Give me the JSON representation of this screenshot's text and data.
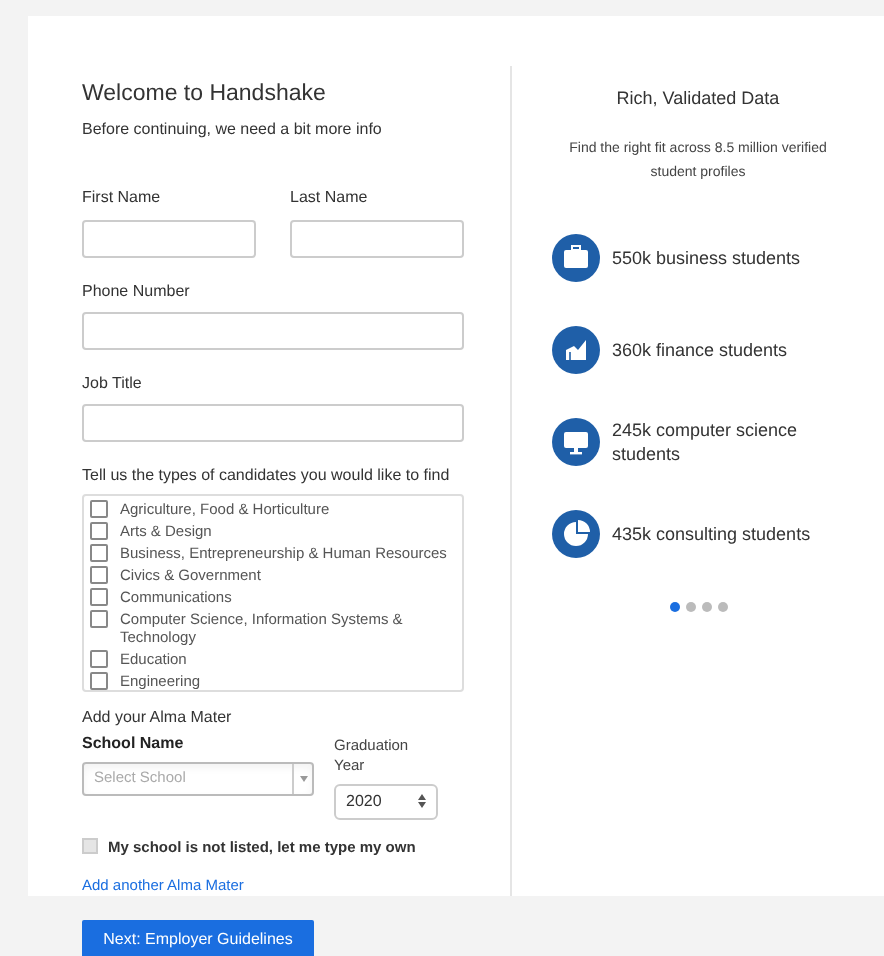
{
  "form": {
    "title": "Welcome to Handshake",
    "subtitle": "Before continuing, we need a bit more info",
    "first_name": {
      "label": "First Name"
    },
    "last_name": {
      "label": "Last Name"
    },
    "phone": {
      "label": "Phone Number"
    },
    "job_title": {
      "label": "Job Title"
    },
    "candidates": {
      "label": "Tell us the types of candidates you would like to find",
      "options": [
        {
          "label": "Agriculture, Food & Horticulture",
          "checked": false
        },
        {
          "label": "Arts & Design",
          "checked": false
        },
        {
          "label": "Business, Entrepreneurship & Human Resources",
          "checked": false
        },
        {
          "label": "Civics & Government",
          "checked": false
        },
        {
          "label": "Communications",
          "checked": false
        },
        {
          "label": "Computer Science, Information Systems & Technology",
          "checked": false
        },
        {
          "label": "Education",
          "checked": false
        },
        {
          "label": "Engineering",
          "checked": false
        }
      ]
    },
    "alma_mater": {
      "heading": "Add your Alma Mater",
      "school_label": "School Name",
      "school_placeholder": "Select School",
      "year_label": "Graduation Year",
      "year_value": "2020",
      "not_listed": {
        "label": "My school is not listed, let me type my own",
        "checked": false
      },
      "add_link": "Add another Alma Mater"
    }
  },
  "promo": {
    "title": "Rich, Validated Data",
    "subtitle": "Find the right fit across 8.5 million verified student profiles",
    "stats": [
      {
        "kind": "briefcase",
        "text": "550k business students"
      },
      {
        "kind": "finance",
        "text": "360k finance students"
      },
      {
        "kind": "monitor",
        "text": "245k computer science students"
      },
      {
        "kind": "pie",
        "text": "435k consulting students"
      }
    ],
    "dots": [
      {
        "selected": true
      },
      {
        "selected": false
      },
      {
        "selected": false
      },
      {
        "selected": false
      }
    ]
  },
  "next_button": "Next: Employer Guidelines"
}
